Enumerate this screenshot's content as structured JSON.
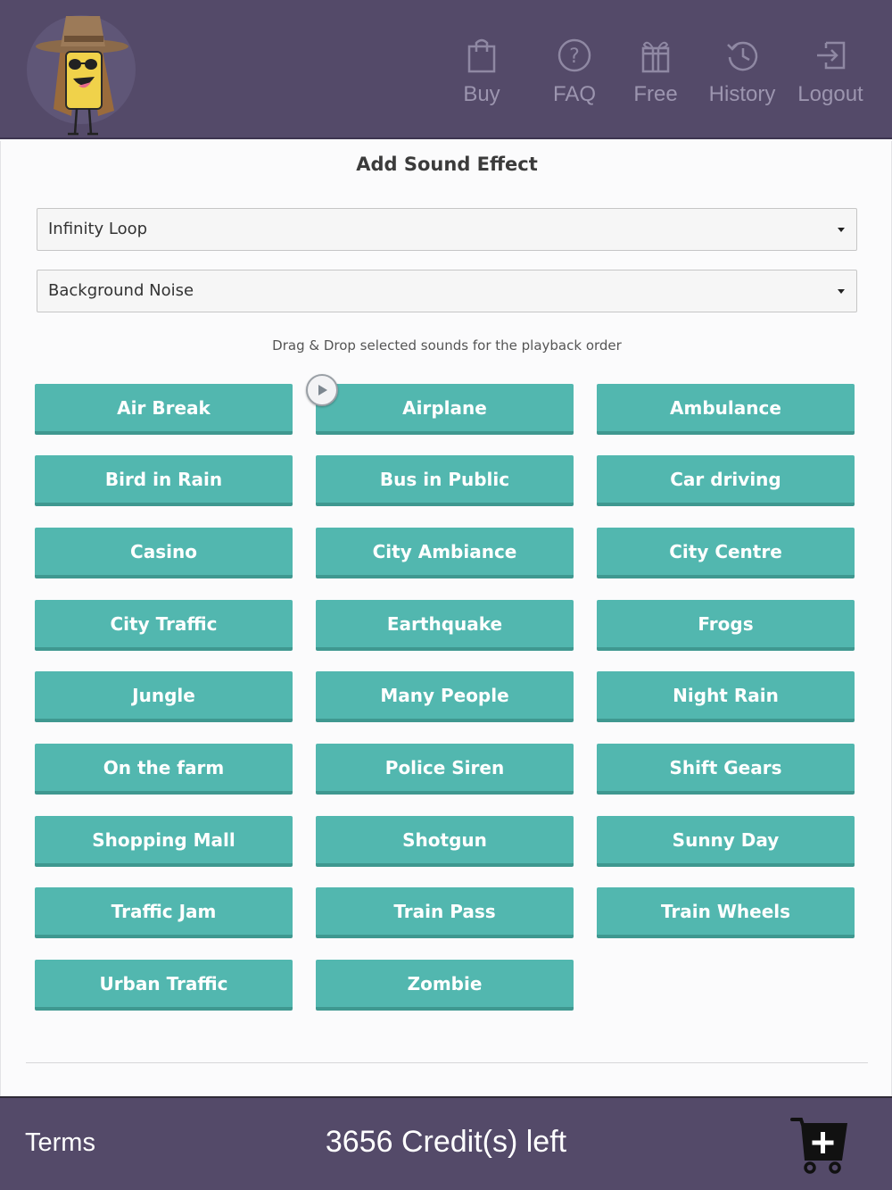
{
  "header": {
    "nav": [
      {
        "label": "Buy",
        "icon": "shopping-bag-icon"
      },
      {
        "label": "FAQ",
        "icon": "question-circle-icon"
      },
      {
        "label": "Free",
        "icon": "gift-icon"
      },
      {
        "label": "History",
        "icon": "history-icon"
      },
      {
        "label": "Logout",
        "icon": "logout-icon"
      }
    ]
  },
  "main": {
    "title": "Add Sound Effect",
    "loop_select": {
      "value": "Infinity Loop"
    },
    "category_select": {
      "value": "Background Noise"
    },
    "hint": "Drag & Drop selected sounds for the playback order",
    "sounds": [
      "Air Break",
      "Airplane",
      "Ambulance",
      "Bird in Rain",
      "Bus in Public",
      "Car driving",
      "Casino",
      "City Ambiance",
      "City Centre",
      "City Traffic",
      "Earthquake",
      "Frogs",
      "Jungle",
      "Many People",
      "Night Rain",
      "On the farm",
      "Police Siren",
      "Shift Gears",
      "Shopping Mall",
      "Shotgun",
      "Sunny Day",
      "Traffic Jam",
      "Train Pass",
      "Train Wheels",
      "Urban Traffic",
      "Zombie"
    ]
  },
  "footer": {
    "terms": "Terms",
    "credits": "3656 Credit(s) left"
  },
  "colors": {
    "brand_purple": "#544a69",
    "sound_button": "#52b7af",
    "sound_button_shadow": "#3f9890"
  }
}
